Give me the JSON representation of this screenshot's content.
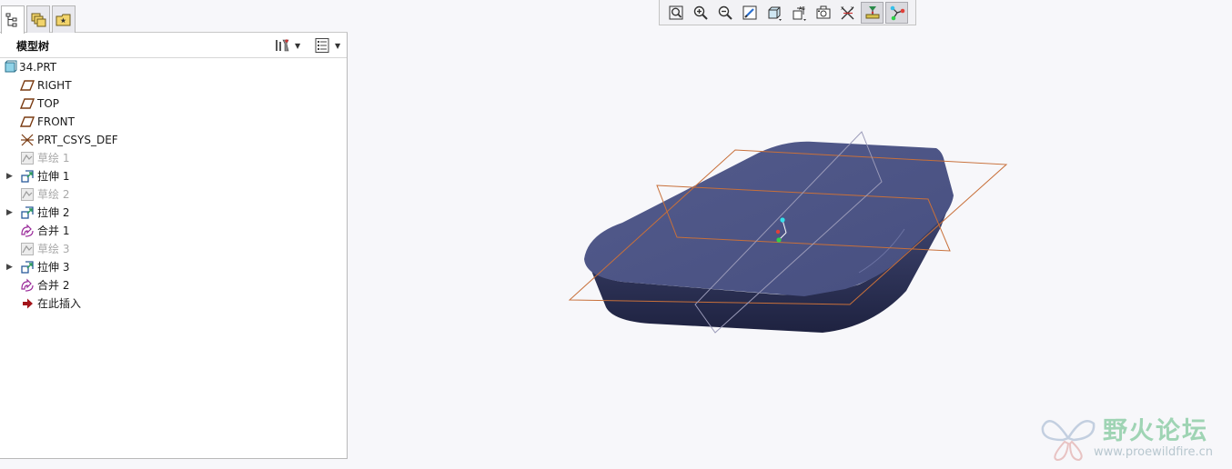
{
  "left_panel": {
    "tabs": [
      {
        "icon": "model-tree-icon"
      },
      {
        "icon": "layers-icon"
      },
      {
        "icon": "favorites-folder-icon"
      }
    ],
    "header": {
      "title": "模型树",
      "settings_icon": "tree-settings-icon",
      "show_icon": "tree-show-icon"
    },
    "tree_items": [
      {
        "label": "34.PRT",
        "icon": "part-icon",
        "expandable": false,
        "dimmed": false,
        "indent": 0
      },
      {
        "label": "RIGHT",
        "icon": "datum-plane-icon",
        "expandable": false,
        "dimmed": false,
        "indent": 1
      },
      {
        "label": "TOP",
        "icon": "datum-plane-icon",
        "expandable": false,
        "dimmed": false,
        "indent": 1
      },
      {
        "label": "FRONT",
        "icon": "datum-plane-icon",
        "expandable": false,
        "dimmed": false,
        "indent": 1
      },
      {
        "label": "PRT_CSYS_DEF",
        "icon": "csys-icon",
        "expandable": false,
        "dimmed": false,
        "indent": 1
      },
      {
        "label": "草绘 1",
        "icon": "sketch-icon",
        "expandable": false,
        "dimmed": true,
        "indent": 1
      },
      {
        "label": "拉伸 1",
        "icon": "extrude-icon",
        "expandable": true,
        "dimmed": false,
        "indent": 1
      },
      {
        "label": "草绘 2",
        "icon": "sketch-icon",
        "expandable": false,
        "dimmed": true,
        "indent": 1
      },
      {
        "label": "拉伸 2",
        "icon": "extrude-icon",
        "expandable": true,
        "dimmed": false,
        "indent": 1
      },
      {
        "label": "合并 1",
        "icon": "merge-icon",
        "expandable": false,
        "dimmed": false,
        "indent": 1
      },
      {
        "label": "草绘 3",
        "icon": "sketch-icon",
        "expandable": false,
        "dimmed": true,
        "indent": 1
      },
      {
        "label": "拉伸 3",
        "icon": "extrude-icon",
        "expandable": true,
        "dimmed": false,
        "indent": 1
      },
      {
        "label": "合并 2",
        "icon": "merge-icon",
        "expandable": false,
        "dimmed": false,
        "indent": 1
      },
      {
        "label": "在此插入",
        "icon": "insert-here-arrow-icon",
        "expandable": false,
        "dimmed": false,
        "indent": 1
      }
    ]
  },
  "toolbar": {
    "buttons": [
      {
        "icon": "refit-icon",
        "pressed": false
      },
      {
        "icon": "zoom-in-icon",
        "pressed": false
      },
      {
        "icon": "zoom-out-icon",
        "pressed": false
      },
      {
        "icon": "repaint-icon",
        "pressed": false
      },
      {
        "icon": "display-style-icon",
        "pressed": false
      },
      {
        "icon": "saved-views-icon",
        "pressed": false
      },
      {
        "icon": "view-manager-icon",
        "pressed": false
      },
      {
        "icon": "datum-display-icon",
        "pressed": false
      },
      {
        "icon": "annotation-display-icon",
        "pressed": true
      },
      {
        "icon": "spin-center-icon",
        "pressed": true
      }
    ]
  },
  "watermark": {
    "title": "野火论坛",
    "url": "www.proewildfire.cn"
  },
  "colors": {
    "part_body": "#4a5282",
    "datum_plane_edge": "#c8703a",
    "background": "#f7f7fa",
    "watermark_green": "#9fd4b4"
  }
}
